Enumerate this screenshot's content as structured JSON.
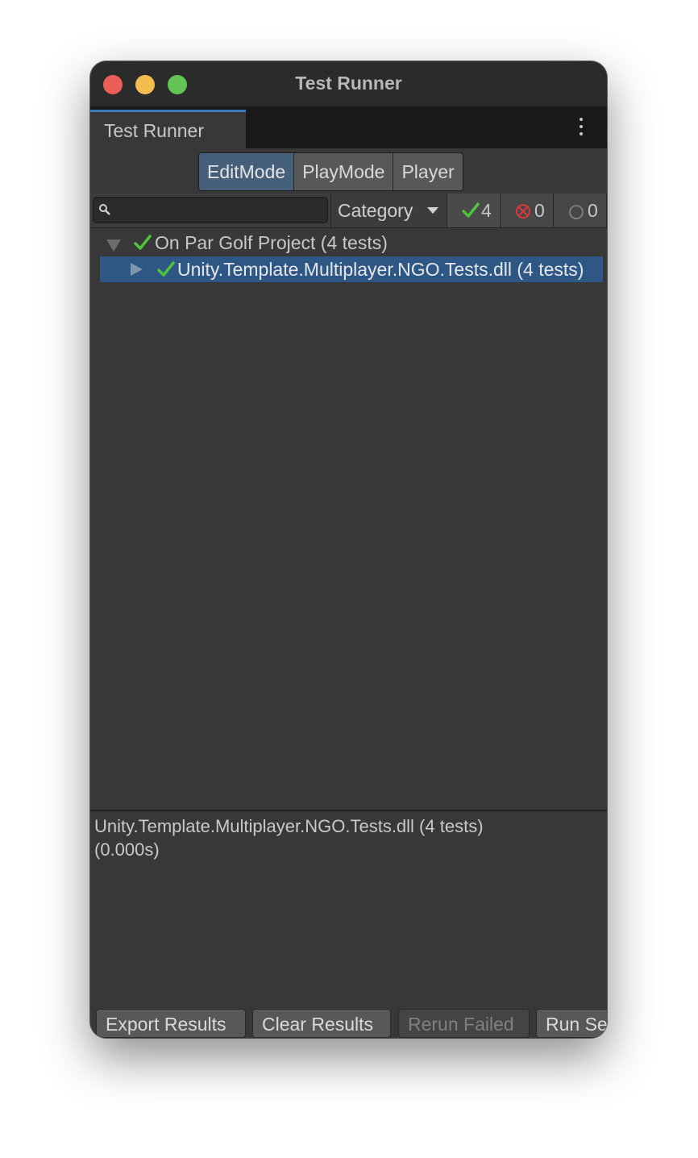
{
  "window": {
    "title": "Test Runner"
  },
  "tab": {
    "label": "Test Runner"
  },
  "modes": [
    {
      "label": "EditMode",
      "active": true
    },
    {
      "label": "PlayMode",
      "active": false
    },
    {
      "label": "Player",
      "active": false
    }
  ],
  "filter": {
    "search_value": "",
    "category_label": "Category",
    "passed_count": "4",
    "failed_count": "0",
    "skipped_count": "0"
  },
  "tree": {
    "root": {
      "label": "On Par Golf Project (4 tests)",
      "status": "passed",
      "expanded": true
    },
    "child": {
      "label": "Unity.Template.Multiplayer.NGO.Tests.dll (4 tests)",
      "status": "passed",
      "expanded": false,
      "selected": true
    }
  },
  "details": {
    "text": "Unity.Template.Multiplayer.NGO.Tests.dll (4 tests)\n(0.000s)"
  },
  "buttons": {
    "export": "Export Results",
    "clear": "Clear Results",
    "rerun": "Rerun Failed",
    "run": "Run Selected"
  },
  "colors": {
    "passed": "#4fc43b",
    "failed": "#d63a3a",
    "selection": "#2e5786",
    "active_mode": "#46607c"
  }
}
